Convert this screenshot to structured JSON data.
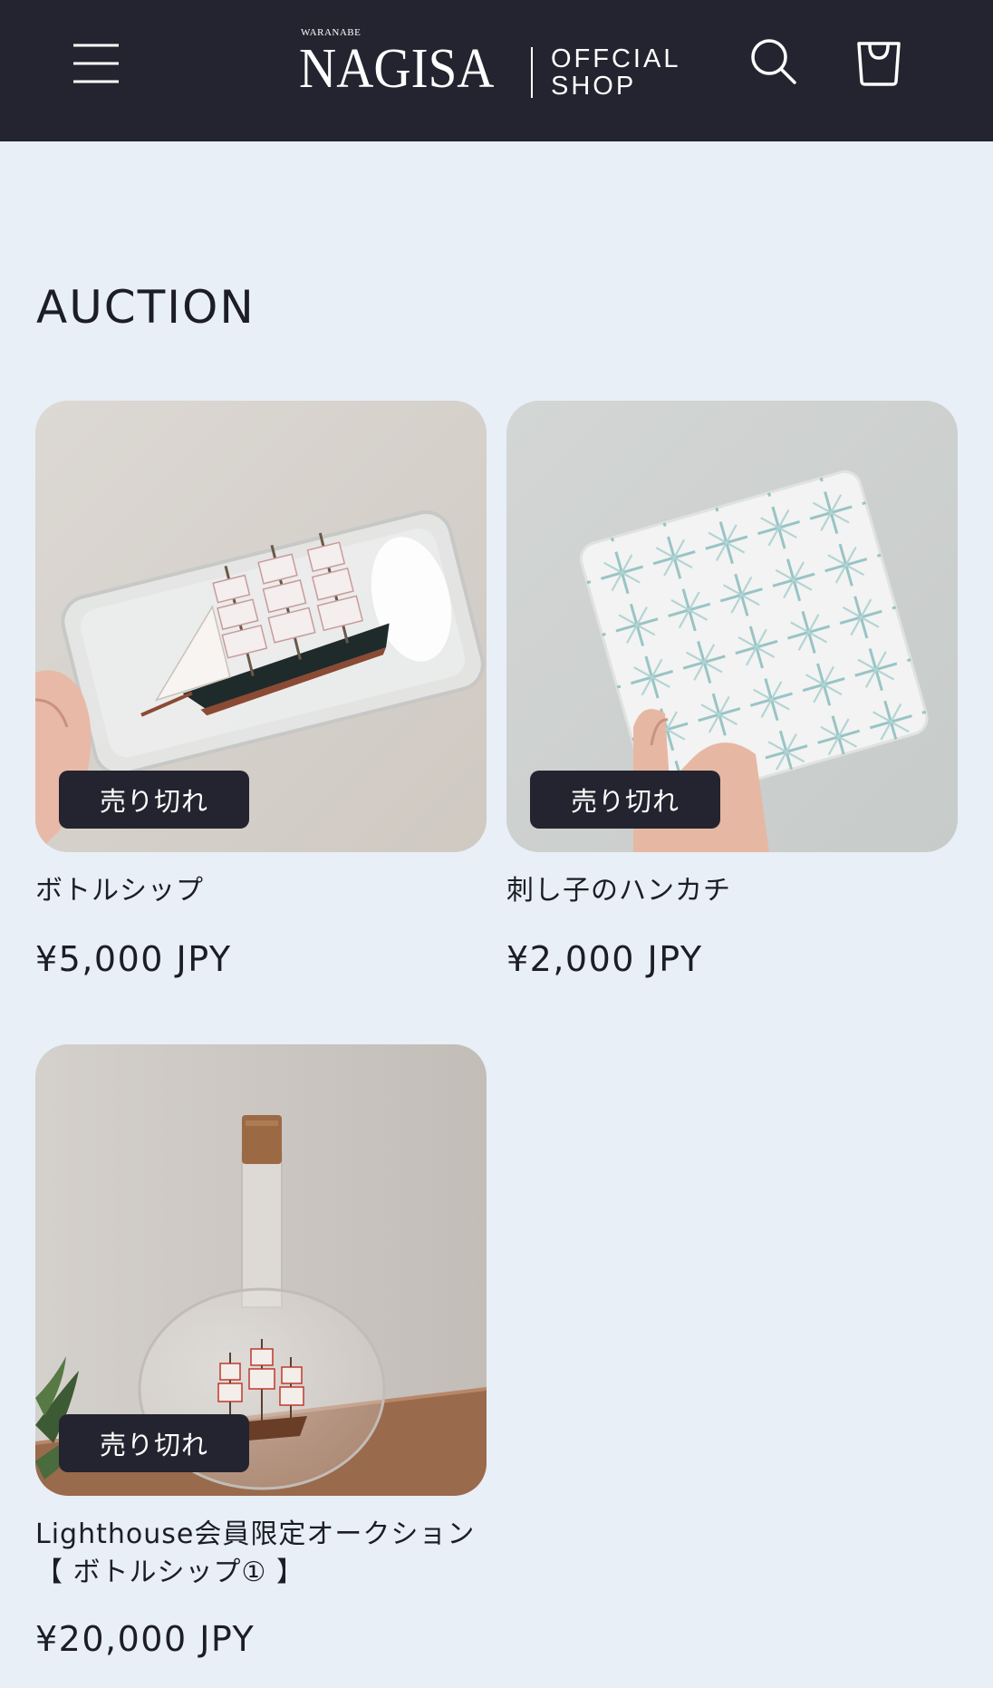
{
  "header": {
    "logo_small": "WARANABE",
    "logo_main": "NAGISA",
    "logo_sub_line1": "OFFCIAL",
    "logo_sub_line2": "SHOP",
    "icons": [
      "menu-icon",
      "search-icon",
      "cart-icon"
    ]
  },
  "collection": {
    "title": "AUCTION"
  },
  "products": [
    {
      "title": "ボトルシップ",
      "price": "¥5,000 JPY",
      "badge": "売り切れ",
      "image": "ship-in-bottle-photo"
    },
    {
      "title": "刺し子のハンカチ",
      "price": "¥2,000 JPY",
      "badge": "売り切れ",
      "image": "sashiko-handkerchief-photo"
    },
    {
      "title": "Lighthouse会員限定オークション【 ボトルシップ① 】",
      "price": "¥20,000 JPY",
      "badge": "売り切れ",
      "image": "ship-in-round-bottle-photo"
    }
  ],
  "colors": {
    "header_bg": "#23242f",
    "page_bg": "#e8eff6",
    "text": "#1c1d26",
    "badge_bg": "#23242f"
  }
}
